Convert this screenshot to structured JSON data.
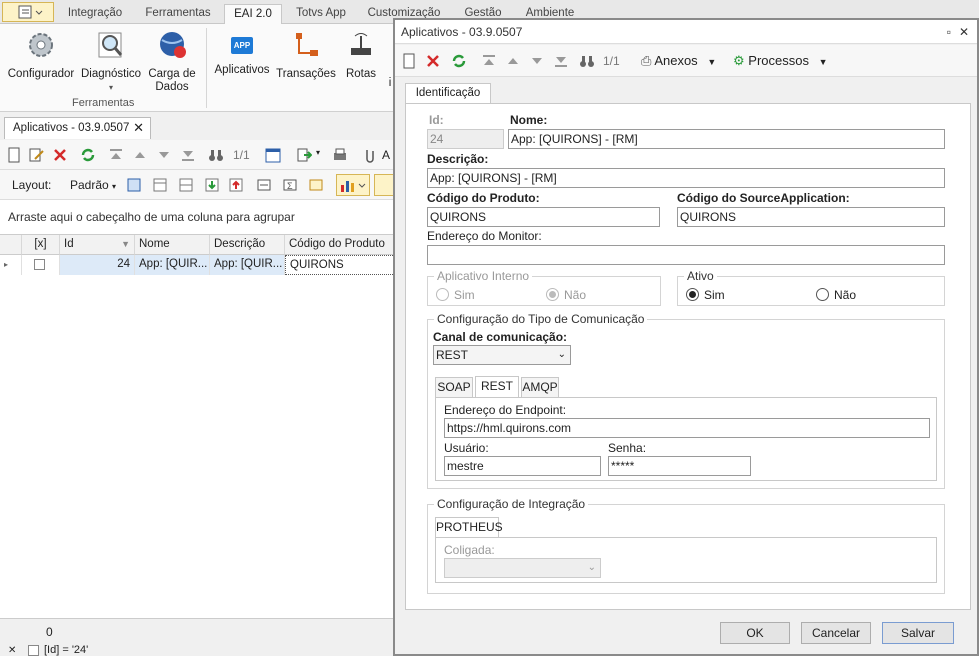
{
  "ribbon": {
    "tabs": [
      "Integração",
      "Ferramentas",
      "EAI 2.0",
      "Totvs App",
      "Customização",
      "Gestão",
      "Ambiente"
    ],
    "buttons": {
      "configurador": "Configurador",
      "diagnostico": "Diagnóstico",
      "carga1": "Carga de",
      "carga2": "Dados",
      "aplicativos": "Aplicativos",
      "transacoes": "Transações",
      "rotas": "Rotas",
      "cut": "i"
    },
    "group_label": "Ferramentas",
    "app_badge": "APP"
  },
  "left": {
    "doc_tab": "Aplicativos - 03.9.0507",
    "pager": "1/1",
    "layout_label": "Layout:",
    "layout_value": "Padrão",
    "group_hint": "Arraste aqui o cabeçalho de uma coluna para agrupar",
    "columns": [
      "[x]",
      "Id",
      "Nome",
      "Descrição",
      "Código do Produto"
    ],
    "row": {
      "id": "24",
      "nome": "App: [QUIR...",
      "descricao": "App: [QUIR...",
      "codigo": "QUIRONS"
    },
    "footer_count": "0",
    "filter": "[Id] = '24'",
    "toolbar_cut": "A"
  },
  "dialog": {
    "title": "Aplicativos - 03.9.0507",
    "pager": "1/1",
    "anexos": "Anexos",
    "processos": "Processos",
    "tab": "Identificação",
    "id_label": "Id:",
    "id_value": "24",
    "nome_label": "Nome:",
    "nome_value": "App: [QUIRONS] - [RM]",
    "descricao_label": "Descrição:",
    "descricao_value": "App: [QUIRONS] - [RM]",
    "codprod_label": "Código do Produto:",
    "codprod_value": "QUIRONS",
    "codsrc_label": "Código do SourceApplication:",
    "codsrc_value": "QUIRONS",
    "monitor_label": "Endereço do Monitor:",
    "monitor_value": "",
    "app_interno_label": "Aplicativo Interno",
    "sim": "Sim",
    "nao": "Não",
    "ativo_label": "Ativo",
    "config_tipo_label": "Configuração do Tipo de Comunicação",
    "canal_label": "Canal de comunicação:",
    "canal_value": "REST",
    "comm_tabs": [
      "SOAP",
      "REST",
      "AMQP"
    ],
    "endpoint_label": "Endereço do Endpoint:",
    "endpoint_value": "https://hml.quirons.com",
    "usuario_label": "Usuário:",
    "usuario_value": "mestre",
    "senha_label": "Senha:",
    "senha_value": "*****",
    "config_integ_label": "Configuração de Integração",
    "integ_tab": "PROTHEUS",
    "coligada_label": "Coligada:",
    "ok": "OK",
    "cancelar": "Cancelar",
    "salvar": "Salvar"
  },
  "colors": {
    "accent_blue": "#1e7ad6",
    "selected_row": "#ddeaf8",
    "delete_red": "#d42a2a",
    "refresh_green": "#2a9a3a"
  }
}
